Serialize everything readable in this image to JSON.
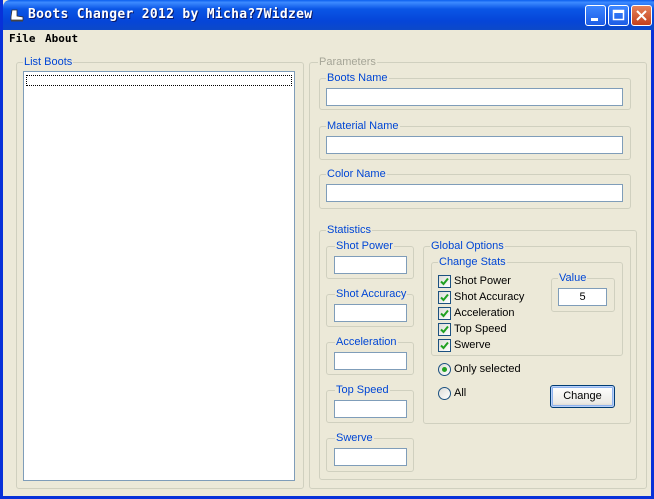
{
  "window": {
    "title": "Boots Changer 2012 by Micha?7Widzew"
  },
  "menu": {
    "file": "File",
    "about": "About"
  },
  "list_boots": {
    "label": "List Boots",
    "items": []
  },
  "parameters": {
    "label": "Parameters",
    "boots_name": {
      "label": "Boots Name",
      "value": ""
    },
    "material_name": {
      "label": "Material Name",
      "value": ""
    },
    "color_name": {
      "label": "Color Name",
      "value": ""
    }
  },
  "statistics": {
    "label": "Statistics",
    "shot_power": {
      "label": "Shot Power",
      "value": ""
    },
    "shot_accuracy": {
      "label": "Shot Accuracy",
      "value": ""
    },
    "acceleration": {
      "label": "Acceleration",
      "value": ""
    },
    "top_speed": {
      "label": "Top Speed",
      "value": ""
    },
    "swerve": {
      "label": "Swerve",
      "value": ""
    }
  },
  "global_options": {
    "label": "Global Options",
    "change_stats": {
      "label": "Change Stats",
      "checks": [
        {
          "label": "Shot Power",
          "checked": true
        },
        {
          "label": "Shot Accuracy",
          "checked": true
        },
        {
          "label": "Acceleration",
          "checked": true
        },
        {
          "label": "Top Speed",
          "checked": true
        },
        {
          "label": "Swerve",
          "checked": true
        }
      ],
      "value": {
        "label": "Value",
        "value": "5"
      }
    },
    "radio_only_selected": {
      "label": "Only selected",
      "selected": true
    },
    "radio_all": {
      "label": "All",
      "selected": false
    },
    "change_button": "Change"
  },
  "colors": {
    "accent_label": "#0046d5",
    "titlebar": "#0a56e6",
    "window_bg": "#ece9d8"
  }
}
